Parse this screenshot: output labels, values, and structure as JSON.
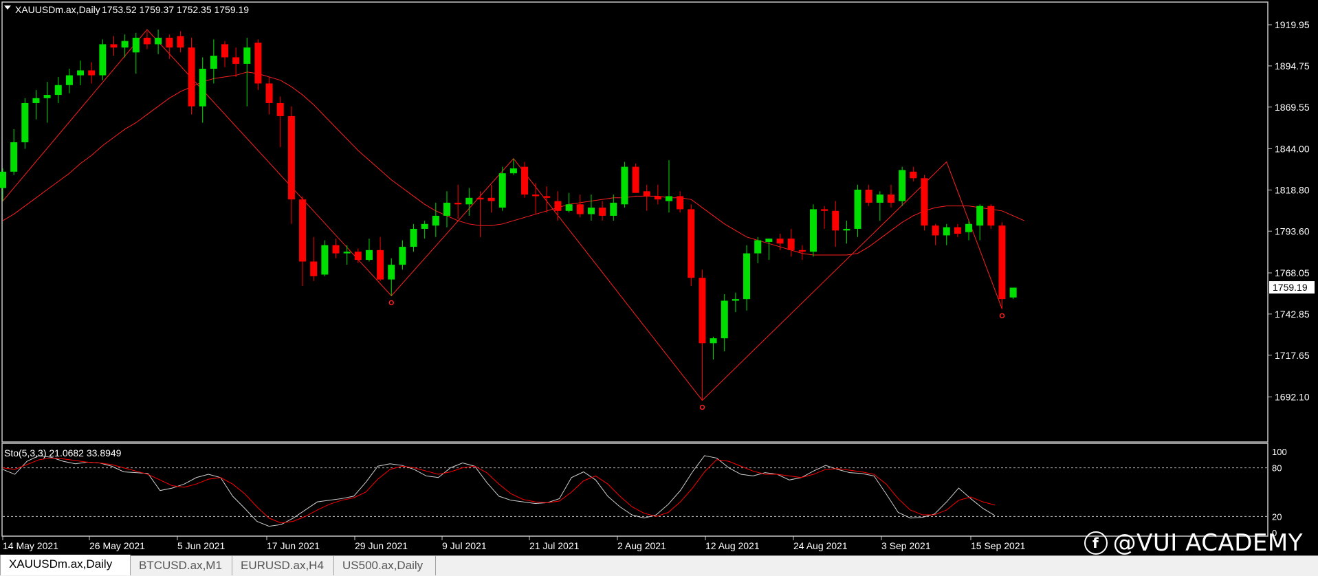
{
  "header": {
    "symbol": "XAUUSDm.ax,Daily",
    "ohlc": "1753.52 1759.37 1752.35 1759.19"
  },
  "stoch_header": "Sto(5,3,3) 21.0682 33.8949",
  "tabs": [
    {
      "label": "XAUUSDm.ax,Daily",
      "active": true
    },
    {
      "label": "BTCUSD.ax,M1",
      "active": false
    },
    {
      "label": "EURUSD.ax,H4",
      "active": false
    },
    {
      "label": "US500.ax,Daily",
      "active": false
    }
  ],
  "brand": "@VUI ACADEMY",
  "chart_data": [
    {
      "type": "candlestick",
      "symbol": "XAUUSDm.ax",
      "timeframe": "Daily",
      "ylim": [
        1670,
        1925
      ],
      "price_ticks": [
        "1919.95",
        "1894.75",
        "1869.55",
        "1844.00",
        "1818.80",
        "1793.60",
        "1768.05",
        "1742.85",
        "1717.65",
        "1692.10"
      ],
      "current_price": "1759.19",
      "x_labels": [
        "14 May 2021",
        "26 May 2021",
        "5 Jun 2021",
        "17 Jun 2021",
        "29 Jun 2021",
        "9 Jul 2021",
        "21 Jul 2021",
        "2 Aug 2021",
        "12 Aug 2021",
        "24 Aug 2021",
        "3 Sep 2021",
        "15 Sep 2021"
      ],
      "up_color": "#00e000",
      "down_color": "#ff0000",
      "candles": [
        [
          1820,
          1832,
          1812,
          1830
        ],
        [
          1830,
          1856,
          1828,
          1848
        ],
        [
          1848,
          1875,
          1844,
          1872
        ],
        [
          1872,
          1880,
          1862,
          1875
        ],
        [
          1875,
          1885,
          1860,
          1877
        ],
        [
          1877,
          1888,
          1872,
          1883
        ],
        [
          1883,
          1893,
          1878,
          1889
        ],
        [
          1889,
          1898,
          1883,
          1892
        ],
        [
          1892,
          1897,
          1884,
          1889
        ],
        [
          1889,
          1911,
          1886,
          1908
        ],
        [
          1908,
          1913,
          1901,
          1906
        ],
        [
          1906,
          1914,
          1900,
          1910
        ],
        [
          1903,
          1915,
          1890,
          1912
        ],
        [
          1912,
          1916,
          1905,
          1908
        ],
        [
          1908,
          1917,
          1902,
          1912
        ],
        [
          1912,
          1914,
          1899,
          1906
        ],
        [
          1913,
          1916,
          1903,
          1906
        ],
        [
          1906,
          1912,
          1865,
          1870
        ],
        [
          1870,
          1900,
          1860,
          1893
        ],
        [
          1893,
          1911,
          1884,
          1901
        ],
        [
          1908,
          1910,
          1894,
          1900
        ],
        [
          1900,
          1906,
          1888,
          1896
        ],
        [
          1896,
          1912,
          1870,
          1906
        ],
        [
          1909,
          1911,
          1880,
          1884
        ],
        [
          1884,
          1888,
          1865,
          1872
        ],
        [
          1872,
          1876,
          1845,
          1864
        ],
        [
          1864,
          1870,
          1798,
          1813
        ],
        [
          1813,
          1815,
          1760,
          1775
        ],
        [
          1775,
          1790,
          1763,
          1766
        ],
        [
          1767,
          1788,
          1766,
          1785
        ],
        [
          1785,
          1789,
          1777,
          1780
        ],
        [
          1780,
          1785,
          1773,
          1781
        ],
        [
          1781,
          1783,
          1774,
          1776
        ],
        [
          1776,
          1789,
          1775,
          1782
        ],
        [
          1782,
          1790,
          1763,
          1764
        ],
        [
          1764,
          1777,
          1754,
          1773
        ],
        [
          1773,
          1788,
          1770,
          1784
        ],
        [
          1784,
          1798,
          1781,
          1795
        ],
        [
          1795,
          1800,
          1789,
          1798
        ],
        [
          1797,
          1811,
          1790,
          1803
        ],
        [
          1803,
          1818,
          1796,
          1811
        ],
        [
          1811,
          1822,
          1801,
          1810
        ],
        [
          1810,
          1820,
          1803,
          1814
        ],
        [
          1814,
          1818,
          1790,
          1813
        ],
        [
          1814,
          1822,
          1805,
          1812
        ],
        [
          1808,
          1833,
          1806,
          1829
        ],
        [
          1829,
          1838,
          1828,
          1832
        ],
        [
          1833,
          1836,
          1814,
          1816
        ],
        [
          1816,
          1823,
          1804,
          1815
        ],
        [
          1815,
          1821,
          1805,
          1814
        ],
        [
          1812,
          1818,
          1800,
          1806
        ],
        [
          1806,
          1817,
          1805,
          1810
        ],
        [
          1810,
          1816,
          1802,
          1804
        ],
        [
          1804,
          1816,
          1800,
          1808
        ],
        [
          1808,
          1812,
          1800,
          1803
        ],
        [
          1803,
          1816,
          1800,
          1811
        ],
        [
          1810,
          1836,
          1808,
          1833
        ],
        [
          1833,
          1835,
          1817,
          1817
        ],
        [
          1818,
          1822,
          1806,
          1815
        ],
        [
          1815,
          1822,
          1810,
          1813
        ],
        [
          1812,
          1837,
          1805,
          1815
        ],
        [
          1815,
          1818,
          1805,
          1807
        ],
        [
          1807,
          1810,
          1760,
          1765
        ],
        [
          1765,
          1770,
          1690,
          1725
        ],
        [
          1725,
          1729,
          1715,
          1728
        ],
        [
          1728,
          1755,
          1720,
          1751
        ],
        [
          1751,
          1756,
          1744,
          1752
        ],
        [
          1752,
          1785,
          1745,
          1780
        ],
        [
          1780,
          1790,
          1774,
          1788
        ],
        [
          1787,
          1789,
          1776,
          1789
        ],
        [
          1789,
          1792,
          1782,
          1786
        ],
        [
          1789,
          1795,
          1778,
          1782
        ],
        [
          1782,
          1785,
          1776,
          1781
        ],
        [
          1781,
          1810,
          1778,
          1807
        ],
        [
          1807,
          1809,
          1795,
          1806
        ],
        [
          1806,
          1812,
          1784,
          1794
        ],
        [
          1794,
          1800,
          1786,
          1795
        ],
        [
          1795,
          1822,
          1790,
          1819
        ],
        [
          1819,
          1822,
          1809,
          1811
        ],
        [
          1811,
          1818,
          1800,
          1816
        ],
        [
          1816,
          1822,
          1808,
          1811
        ],
        [
          1812,
          1833,
          1809,
          1831
        ],
        [
          1830,
          1833,
          1824,
          1826
        ],
        [
          1826,
          1828,
          1794,
          1797
        ],
        [
          1797,
          1798,
          1785,
          1791
        ],
        [
          1791,
          1798,
          1785,
          1796
        ],
        [
          1796,
          1798,
          1790,
          1792
        ],
        [
          1793,
          1800,
          1788,
          1798
        ],
        [
          1797,
          1810,
          1788,
          1809
        ],
        [
          1809,
          1810,
          1795,
          1797
        ],
        [
          1797,
          1799,
          1746,
          1752
        ],
        [
          1753,
          1759,
          1752,
          1759
        ]
      ],
      "moving_average": [
        1800,
        1804,
        1809,
        1814,
        1819,
        1824,
        1829,
        1835,
        1840,
        1846,
        1851,
        1856,
        1860,
        1865,
        1870,
        1875,
        1879,
        1882,
        1885,
        1887,
        1888,
        1889,
        1891,
        1890,
        1888,
        1886,
        1882,
        1877,
        1871,
        1864,
        1857,
        1850,
        1843,
        1837,
        1831,
        1825,
        1820,
        1815,
        1810,
        1806,
        1803,
        1800,
        1798,
        1797,
        1797,
        1798,
        1800,
        1802,
        1804,
        1806,
        1808,
        1810,
        1811,
        1812,
        1813,
        1814,
        1814,
        1815,
        1815,
        1815,
        1814,
        1814,
        1813,
        1808,
        1803,
        1798,
        1794,
        1790,
        1788,
        1786,
        1784,
        1782,
        1780,
        1779,
        1779,
        1779,
        1779,
        1780,
        1784,
        1789,
        1794,
        1799,
        1803,
        1806,
        1808,
        1809,
        1809,
        1809,
        1808,
        1807,
        1806,
        1803,
        1800
      ],
      "zigzag": [
        {
          "i": 0,
          "price": 1812
        },
        {
          "i": 13,
          "price": 1917
        },
        {
          "i": 35,
          "price": 1754
        },
        {
          "i": 46,
          "price": 1838
        },
        {
          "i": 63,
          "price": 1690
        },
        {
          "i": 85,
          "price": 1836
        },
        {
          "i": 90,
          "price": 1746
        }
      ],
      "pivot_marks": [
        35,
        63,
        90
      ]
    },
    {
      "type": "line",
      "title": "Sto(5,3,3) 21.0682 33.8949",
      "ylim": [
        0,
        100
      ],
      "levels": [
        20,
        80
      ],
      "y_ticks": [
        "100",
        "80",
        "20",
        "0"
      ],
      "series": [
        {
          "color": "#d0d0d0",
          "values": [
            78,
            72,
            88,
            95,
            93,
            88,
            85,
            87,
            86,
            82,
            75,
            74,
            73,
            52,
            55,
            60,
            68,
            72,
            68,
            45,
            30,
            14,
            8,
            10,
            18,
            28,
            38,
            40,
            42,
            45,
            62,
            82,
            85,
            83,
            78,
            70,
            68,
            80,
            86,
            82,
            62,
            45,
            40,
            38,
            36,
            37,
            42,
            68,
            75,
            65,
            45,
            32,
            22,
            18,
            22,
            35,
            52,
            75,
            95,
            92,
            80,
            72,
            70,
            74,
            72,
            65,
            68,
            76,
            83,
            78,
            74,
            73,
            70,
            48,
            25,
            18,
            19,
            23,
            38,
            55,
            42,
            30,
            21
          ]
        },
        {
          "color": "#ff0000",
          "values": [
            80,
            78,
            84,
            90,
            92,
            91,
            89,
            87,
            86,
            84,
            80,
            76,
            72,
            65,
            58,
            56,
            60,
            66,
            68,
            60,
            48,
            32,
            18,
            12,
            14,
            20,
            28,
            35,
            40,
            43,
            50,
            66,
            78,
            82,
            80,
            76,
            72,
            75,
            80,
            82,
            74,
            60,
            48,
            41,
            38,
            37,
            39,
            50,
            64,
            70,
            60,
            45,
            32,
            24,
            20,
            25,
            38,
            55,
            75,
            90,
            88,
            82,
            76,
            72,
            72,
            70,
            68,
            72,
            78,
            79,
            77,
            75,
            72,
            60,
            42,
            28,
            22,
            22,
            28,
            40,
            44,
            38,
            34
          ]
        }
      ]
    }
  ]
}
